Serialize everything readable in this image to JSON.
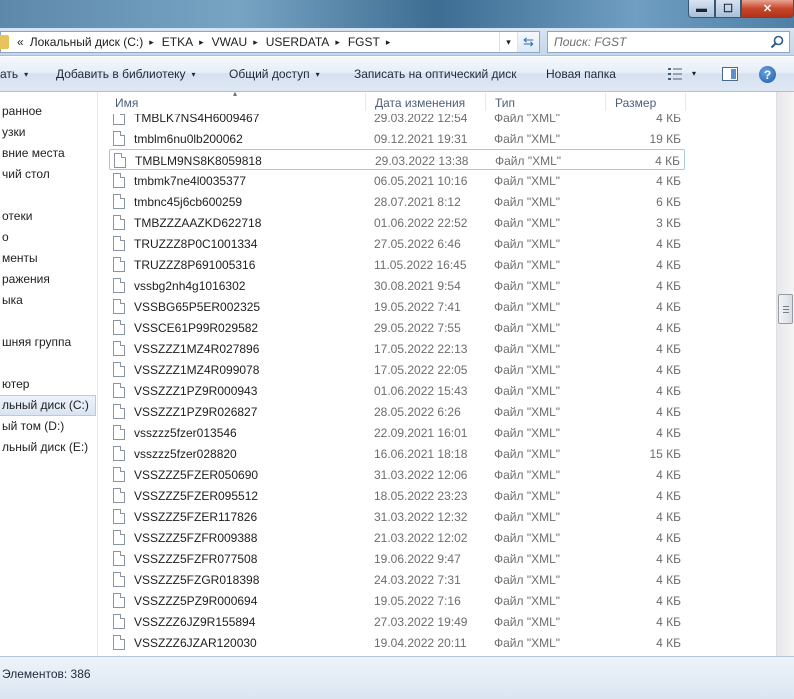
{
  "window": {
    "min_glyph": "▬",
    "max_glyph": "☐",
    "close_glyph": "✕"
  },
  "address": {
    "overflow_glyph": "«",
    "crumbs": [
      "Локальный диск (C:)",
      "ETKA",
      "VWAU",
      "USERDATA",
      "FGST"
    ],
    "arrow_glyph": "▸",
    "dropdown_glyph": "▾",
    "refresh_glyph": "⇆"
  },
  "search": {
    "placeholder": "Поиск: FGST"
  },
  "toolbar": {
    "organize_tail": "ать",
    "add_library": "Добавить в библиотеку",
    "share": "Общий доступ",
    "burn": "Записать на оптический диск",
    "new_folder": "Новая папка",
    "dropdown_glyph": "▾",
    "help_glyph": "?"
  },
  "nav": [
    {
      "label": "ранное",
      "selected": false
    },
    {
      "label": "узки",
      "selected": false
    },
    {
      "label": "вние места",
      "selected": false
    },
    {
      "label": "чий стол",
      "selected": false
    },
    {
      "label": "",
      "selected": false
    },
    {
      "label": "отеки",
      "selected": false
    },
    {
      "label": "о",
      "selected": false
    },
    {
      "label": "менты",
      "selected": false
    },
    {
      "label": "ражения",
      "selected": false
    },
    {
      "label": "ыка",
      "selected": false
    },
    {
      "label": "",
      "selected": false
    },
    {
      "label": "шняя группа",
      "selected": false
    },
    {
      "label": "",
      "selected": false
    },
    {
      "label": "ютер",
      "selected": false
    },
    {
      "label": "льный диск (C:)",
      "selected": true
    },
    {
      "label": "ый том (D:)",
      "selected": false
    },
    {
      "label": "льный диск (E:)",
      "selected": false
    }
  ],
  "columns": {
    "name": "Имя",
    "date": "Дата изменения",
    "type": "Тип",
    "size": "Размер",
    "sort_glyph": "▴"
  },
  "files": [
    {
      "name": "TMBLK7NS4H6009467",
      "date": "29.03.2022 12:54",
      "type": "Файл \"XML\"",
      "size": "4 КБ",
      "selected": false
    },
    {
      "name": "tmblm6nu0lb200062",
      "date": "09.12.2021 19:31",
      "type": "Файл \"XML\"",
      "size": "19 КБ",
      "selected": false
    },
    {
      "name": "TMBLM9NS8K8059818",
      "date": "29.03.2022 13:38",
      "type": "Файл \"XML\"",
      "size": "4 КБ",
      "selected": true
    },
    {
      "name": "tmbmk7ne4l0035377",
      "date": "06.05.2021 10:16",
      "type": "Файл \"XML\"",
      "size": "4 КБ",
      "selected": false
    },
    {
      "name": "tmbnc45j6cb600259",
      "date": "28.07.2021 8:12",
      "type": "Файл \"XML\"",
      "size": "6 КБ",
      "selected": false
    },
    {
      "name": "TMBZZZAAZKD622718",
      "date": "01.06.2022 22:52",
      "type": "Файл \"XML\"",
      "size": "3 КБ",
      "selected": false
    },
    {
      "name": "TRUZZZ8P0C1001334",
      "date": "27.05.2022 6:46",
      "type": "Файл \"XML\"",
      "size": "4 КБ",
      "selected": false
    },
    {
      "name": "TRUZZZ8P691005316",
      "date": "11.05.2022 16:45",
      "type": "Файл \"XML\"",
      "size": "4 КБ",
      "selected": false
    },
    {
      "name": "vssbg2nh4g1016302",
      "date": "30.08.2021 9:54",
      "type": "Файл \"XML\"",
      "size": "4 КБ",
      "selected": false
    },
    {
      "name": "VSSBG65P5ER002325",
      "date": "19.05.2022 7:41",
      "type": "Файл \"XML\"",
      "size": "4 КБ",
      "selected": false
    },
    {
      "name": "VSSCE61P99R029582",
      "date": "29.05.2022 7:55",
      "type": "Файл \"XML\"",
      "size": "4 КБ",
      "selected": false
    },
    {
      "name": "VSSZZZ1MZ4R027896",
      "date": "17.05.2022 22:13",
      "type": "Файл \"XML\"",
      "size": "4 КБ",
      "selected": false
    },
    {
      "name": "VSSZZZ1MZ4R099078",
      "date": "17.05.2022 22:05",
      "type": "Файл \"XML\"",
      "size": "4 КБ",
      "selected": false
    },
    {
      "name": "VSSZZZ1PZ9R000943",
      "date": "01.06.2022 15:43",
      "type": "Файл \"XML\"",
      "size": "4 КБ",
      "selected": false
    },
    {
      "name": "VSSZZZ1PZ9R026827",
      "date": "28.05.2022 6:26",
      "type": "Файл \"XML\"",
      "size": "4 КБ",
      "selected": false
    },
    {
      "name": "vsszzz5fzer013546",
      "date": "22.09.2021 16:01",
      "type": "Файл \"XML\"",
      "size": "4 КБ",
      "selected": false
    },
    {
      "name": "vsszzz5fzer028820",
      "date": "16.06.2021 18:18",
      "type": "Файл \"XML\"",
      "size": "15 КБ",
      "selected": false
    },
    {
      "name": "VSSZZZ5FZER050690",
      "date": "31.03.2022 12:06",
      "type": "Файл \"XML\"",
      "size": "4 КБ",
      "selected": false
    },
    {
      "name": "VSSZZZ5FZER095512",
      "date": "18.05.2022 23:23",
      "type": "Файл \"XML\"",
      "size": "4 КБ",
      "selected": false
    },
    {
      "name": "VSSZZZ5FZER117826",
      "date": "31.03.2022 12:32",
      "type": "Файл \"XML\"",
      "size": "4 КБ",
      "selected": false
    },
    {
      "name": "VSSZZZ5FZFR009388",
      "date": "21.03.2022 12:02",
      "type": "Файл \"XML\"",
      "size": "4 КБ",
      "selected": false
    },
    {
      "name": "VSSZZZ5FZFR077508",
      "date": "19.06.2022 9:47",
      "type": "Файл \"XML\"",
      "size": "4 КБ",
      "selected": false
    },
    {
      "name": "VSSZZZ5FZGR018398",
      "date": "24.03.2022 7:31",
      "type": "Файл \"XML\"",
      "size": "4 КБ",
      "selected": false
    },
    {
      "name": "VSSZZZ5PZ9R000694",
      "date": "19.05.2022 7:16",
      "type": "Файл \"XML\"",
      "size": "4 КБ",
      "selected": false
    },
    {
      "name": "VSSZZZ6JZ9R155894",
      "date": "27.03.2022 19:49",
      "type": "Файл \"XML\"",
      "size": "4 КБ",
      "selected": false
    },
    {
      "name": "VSSZZZ6JZAR120030",
      "date": "19.04.2022 20:11",
      "type": "Файл \"XML\"",
      "size": "4 КБ",
      "selected": false
    }
  ],
  "status": {
    "items_count": "Элементов: 386"
  },
  "colors": {
    "selection_border": "#a5c7ee",
    "header_text": "#4c607a",
    "detail_text": "#6d6d6d"
  }
}
